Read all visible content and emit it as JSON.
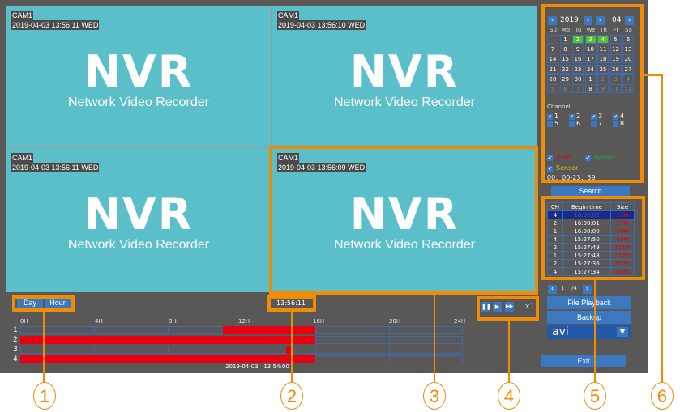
{
  "cameras": [
    {
      "name": "CAM1",
      "timestamp": "2019-04-03 13:56:11 WED",
      "logo_title": "NVR",
      "logo_subtitle": "Network Video Recorder"
    },
    {
      "name": "CAM1",
      "timestamp": "2019-04-03 13:56:10 WED",
      "logo_title": "NVR",
      "logo_subtitle": "Network Video Recorder"
    },
    {
      "name": "CAM1",
      "timestamp": "2019-04-03 13:56:11 WED",
      "logo_title": "NVR",
      "logo_subtitle": "Network Video Recorder"
    },
    {
      "name": "CAM1",
      "timestamp": "2019-04-03 13:56:09 WED",
      "logo_title": "NVR",
      "logo_subtitle": "Network Video Recorder"
    }
  ],
  "timeline": {
    "mode_buttons": [
      "Day",
      "Hour"
    ],
    "current_time": "13:56:11",
    "hour_labels": [
      "0H",
      "4H",
      "8H",
      "12H",
      "16H",
      "20H",
      "24H"
    ],
    "rows": [
      {
        "channel": "1",
        "recorded_hours": [
          [
            11,
            16
          ]
        ]
      },
      {
        "channel": "2",
        "recorded_hours": [
          [
            0,
            16
          ]
        ]
      },
      {
        "channel": "3",
        "recorded_hours": [
          [
            14.4,
            14.7
          ]
        ]
      },
      {
        "channel": "4",
        "recorded_hours": [
          [
            0,
            16
          ]
        ]
      }
    ],
    "cursor_label": "2019-04-03   13:54:00"
  },
  "playback": {
    "pause_icon": "pause-icon",
    "play_icon": "play-icon",
    "fast_forward_icon": "fast-forward-icon",
    "speed": "x1"
  },
  "calendar": {
    "year": "2019",
    "month": "04",
    "weekdays": [
      "Su",
      "Mo",
      "Tu",
      "We",
      "Th",
      "Fr",
      "Sa"
    ],
    "weeks": [
      [
        {
          "d": ""
        },
        {
          "d": "1"
        },
        {
          "d": "2",
          "sel": true
        },
        {
          "d": "3",
          "sel": true
        },
        {
          "d": "4",
          "sel": true
        },
        {
          "d": "5"
        },
        {
          "d": "6"
        }
      ],
      [
        {
          "d": "7"
        },
        {
          "d": "8"
        },
        {
          "d": "9"
        },
        {
          "d": "10"
        },
        {
          "d": "11"
        },
        {
          "d": "12"
        },
        {
          "d": "13"
        }
      ],
      [
        {
          "d": "14"
        },
        {
          "d": "15"
        },
        {
          "d": "16"
        },
        {
          "d": "17"
        },
        {
          "d": "18"
        },
        {
          "d": "19"
        },
        {
          "d": "20"
        }
      ],
      [
        {
          "d": "21"
        },
        {
          "d": "22"
        },
        {
          "d": "23"
        },
        {
          "d": "24"
        },
        {
          "d": "25"
        },
        {
          "d": "26"
        },
        {
          "d": "27"
        }
      ],
      [
        {
          "d": "28"
        },
        {
          "d": "29"
        },
        {
          "d": "30"
        },
        {
          "d": "1"
        },
        {
          "d": "2",
          "dim": true
        },
        {
          "d": "3",
          "dim": true
        },
        {
          "d": "4",
          "dim": true
        }
      ],
      [
        {
          "d": "5",
          "dim": true
        },
        {
          "d": "6",
          "dim": true
        },
        {
          "d": "7",
          "dim": true
        },
        {
          "d": "8"
        },
        {
          "d": "9",
          "dim": true
        },
        {
          "d": "10",
          "dim": true
        },
        {
          "d": "11",
          "dim": true
        }
      ]
    ]
  },
  "channel_filter": {
    "title": "Channel",
    "channels": [
      {
        "label": "1",
        "checked": true
      },
      {
        "label": "2",
        "checked": true
      },
      {
        "label": "3",
        "checked": true
      },
      {
        "label": "4",
        "checked": true
      },
      {
        "label": "5",
        "checked": false
      },
      {
        "label": "6",
        "checked": false
      },
      {
        "label": "7",
        "checked": false
      },
      {
        "label": "8",
        "checked": false
      }
    ]
  },
  "record_types": [
    {
      "label": "Time",
      "checked": true,
      "color": "#e60012"
    },
    {
      "label": "Motion",
      "checked": true,
      "color": "#2ea043"
    },
    {
      "label": "Sensor",
      "checked": true,
      "color": "#d4c21a"
    }
  ],
  "time_range": "00：00-23：59",
  "search_label": "Search",
  "file_table": {
    "headers": [
      "CH",
      "Begin time",
      "Size"
    ],
    "rows": [
      {
        "ch": "4",
        "begin": "16:00:02",
        "size": "17M",
        "active": true
      },
      {
        "ch": "2",
        "begin": "16:00:01",
        "size": "27M"
      },
      {
        "ch": "1",
        "begin": "16:00:00",
        "size": "28M"
      },
      {
        "ch": "4",
        "begin": "15:27:50",
        "size": "46M"
      },
      {
        "ch": "2",
        "begin": "15:27:49",
        "size": "111M"
      },
      {
        "ch": "1",
        "begin": "15:27:48",
        "size": "117M"
      },
      {
        "ch": "2",
        "begin": "15:27:36",
        "size": "602K"
      },
      {
        "ch": "4",
        "begin": "15:27:34",
        "size": "259K"
      }
    ]
  },
  "pager": {
    "current": "1",
    "total": "/4"
  },
  "file_playback_label": "File Playback",
  "backup_label": "Backup",
  "format_select": "avi",
  "exit_label": "Exit",
  "callouts": [
    "1",
    "2",
    "3",
    "4",
    "5",
    "6"
  ],
  "colors": {
    "accent_orange": "#f08b06",
    "button_blue": "#3c78c0",
    "record_red": "#e60012",
    "video_bg": "#5bbfca",
    "panel_gray": "#595856"
  }
}
